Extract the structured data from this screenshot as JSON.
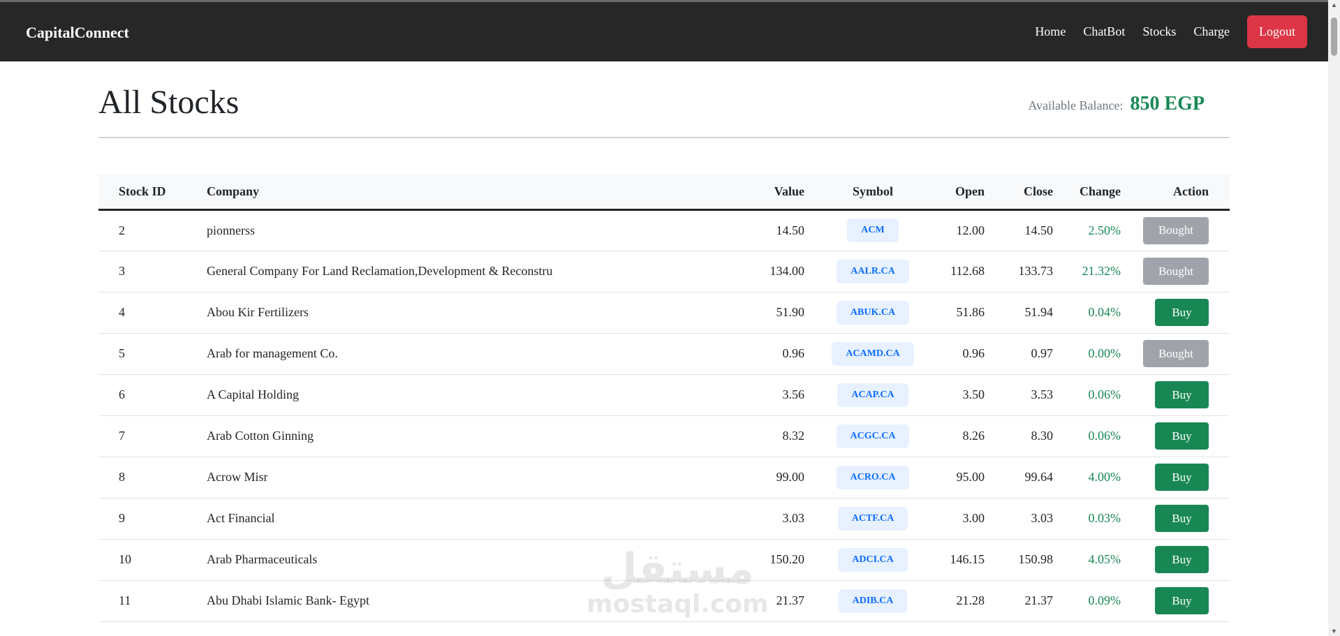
{
  "navbar": {
    "brand": "CapitalConnect",
    "links": [
      "Home",
      "ChatBot",
      "Stocks",
      "Charge"
    ],
    "logout": "Logout"
  },
  "page": {
    "title": "All Stocks",
    "balance_label": "Available Balance:",
    "balance_value": "850 EGP"
  },
  "table": {
    "headers": [
      "Stock ID",
      "Company",
      "Value",
      "Symbol",
      "Open",
      "Close",
      "Change",
      "Action"
    ],
    "rows": [
      {
        "id": "2",
        "company": "pionnerss",
        "value": "14.50",
        "symbol": "ACM",
        "open": "12.00",
        "close": "14.50",
        "change": "2.50%",
        "action": "Bought"
      },
      {
        "id": "3",
        "company": "General Company For Land Reclamation,Development & Reconstru",
        "value": "134.00",
        "symbol": "AALR.CA",
        "open": "112.68",
        "close": "133.73",
        "change": "21.32%",
        "action": "Bought"
      },
      {
        "id": "4",
        "company": "Abou Kir Fertilizers",
        "value": "51.90",
        "symbol": "ABUK.CA",
        "open": "51.86",
        "close": "51.94",
        "change": "0.04%",
        "action": "Buy"
      },
      {
        "id": "5",
        "company": "Arab for management Co.",
        "value": "0.96",
        "symbol": "ACAMD.CA",
        "open": "0.96",
        "close": "0.97",
        "change": "0.00%",
        "action": "Bought"
      },
      {
        "id": "6",
        "company": "A Capital Holding",
        "value": "3.56",
        "symbol": "ACAP.CA",
        "open": "3.50",
        "close": "3.53",
        "change": "0.06%",
        "action": "Buy"
      },
      {
        "id": "7",
        "company": "Arab Cotton Ginning",
        "value": "8.32",
        "symbol": "ACGC.CA",
        "open": "8.26",
        "close": "8.30",
        "change": "0.06%",
        "action": "Buy"
      },
      {
        "id": "8",
        "company": "Acrow Misr",
        "value": "99.00",
        "symbol": "ACRO.CA",
        "open": "95.00",
        "close": "99.64",
        "change": "4.00%",
        "action": "Buy"
      },
      {
        "id": "9",
        "company": "Act Financial",
        "value": "3.03",
        "symbol": "ACTF.CA",
        "open": "3.00",
        "close": "3.03",
        "change": "0.03%",
        "action": "Buy"
      },
      {
        "id": "10",
        "company": "Arab Pharmaceuticals",
        "value": "150.20",
        "symbol": "ADCI.CA",
        "open": "146.15",
        "close": "150.98",
        "change": "4.05%",
        "action": "Buy"
      },
      {
        "id": "11",
        "company": "Abu Dhabi Islamic Bank- Egypt",
        "value": "21.37",
        "symbol": "ADIB.CA",
        "open": "21.28",
        "close": "21.37",
        "change": "0.09%",
        "action": "Buy"
      }
    ]
  },
  "watermark": {
    "arabic": "مستقل",
    "latin": "mostaql.com"
  }
}
